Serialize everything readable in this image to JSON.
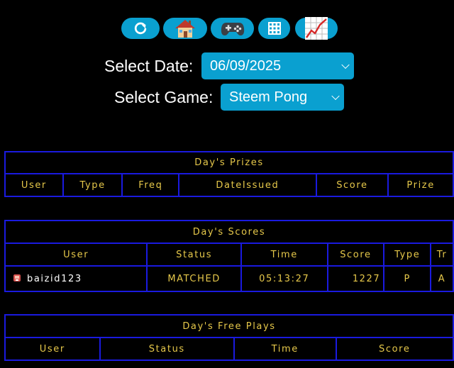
{
  "toolbar": {
    "buttons": [
      {
        "name": "refresh",
        "icon": "refresh-icon"
      },
      {
        "name": "home",
        "icon": "house-icon"
      },
      {
        "name": "games",
        "icon": "gamepad-icon"
      },
      {
        "name": "calendar",
        "icon": "grid-icon"
      },
      {
        "name": "stats",
        "icon": "chart-increasing-icon"
      }
    ]
  },
  "filters": {
    "date_label": "Select Date:",
    "date_value": "06/09/2025",
    "game_label": "Select Game:",
    "game_value": "Steem Pong"
  },
  "prizes": {
    "title": "Day's Prizes",
    "columns": [
      "User",
      "Type",
      "Freq",
      "DateIssued",
      "Score",
      "Prize"
    ]
  },
  "scores": {
    "title": "Day's Scores",
    "columns": [
      "User",
      "Status",
      "Time",
      "Score",
      "Type",
      "Tr"
    ],
    "rows": [
      {
        "user": "baizid123",
        "status": "MATCHED",
        "time": "05:13:27",
        "score": "1227",
        "type": "P",
        "tr": "A"
      }
    ]
  },
  "free_plays": {
    "title": "Day's Free Plays",
    "columns": [
      "User",
      "Status",
      "Time",
      "Score"
    ]
  },
  "colors": {
    "accent": "#0aa0d0",
    "table_border": "#1a1adf",
    "table_text": "#e6c84a",
    "background": "#000000"
  }
}
